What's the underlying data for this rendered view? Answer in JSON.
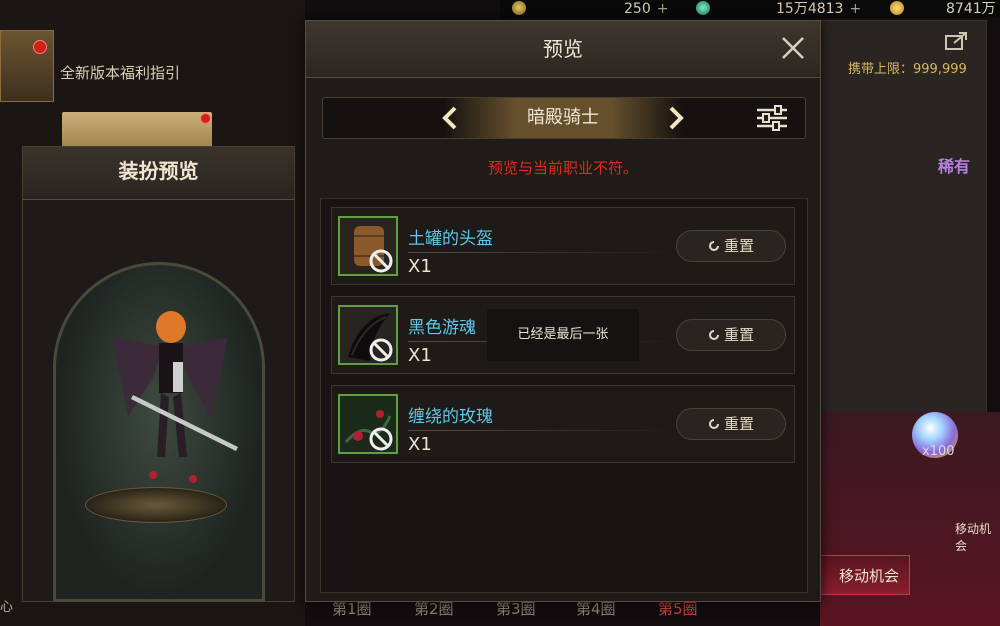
{
  "currency": [
    {
      "icon": "coin-icon",
      "value": "250",
      "plus": "+"
    },
    {
      "icon": "gem-icon",
      "value": "15万4813",
      "plus": "+"
    },
    {
      "icon": "gold-icon",
      "value": "8741万"
    }
  ],
  "background": {
    "welfare_guide": "全新版本福利指引",
    "carry_limit": "携带上限：999,999",
    "rarity": "稀有",
    "orb_count": "x100",
    "move_chance_label": "移动机会",
    "move_chance_button": "移动机会",
    "center_label": "心",
    "floors": [
      "第1圈",
      "第2圈",
      "第3圈",
      "第4圈",
      "第5圈"
    ],
    "active_floor_index": 4
  },
  "outfit_preview": {
    "title": "装扮预览"
  },
  "dialog": {
    "title": "预览",
    "class_name": "暗殿骑士",
    "warning": "预览与当前职业不符。",
    "reset_label": "重置",
    "items": [
      {
        "name": "土罐的头盔",
        "qty": "X1",
        "icon": "pot-helmet-icon"
      },
      {
        "name": "黑色游魂",
        "qty": "X1",
        "icon": "black-wraith-icon"
      },
      {
        "name": "缠绕的玫瑰",
        "qty": "X1",
        "icon": "twined-rose-icon"
      }
    ]
  },
  "toast": "已经是最后一张",
  "colors": {
    "warning": "#e02a1e",
    "item_name": "#5fc8e8",
    "rarity": "#b880e0",
    "icon_border": "#5fa040"
  }
}
